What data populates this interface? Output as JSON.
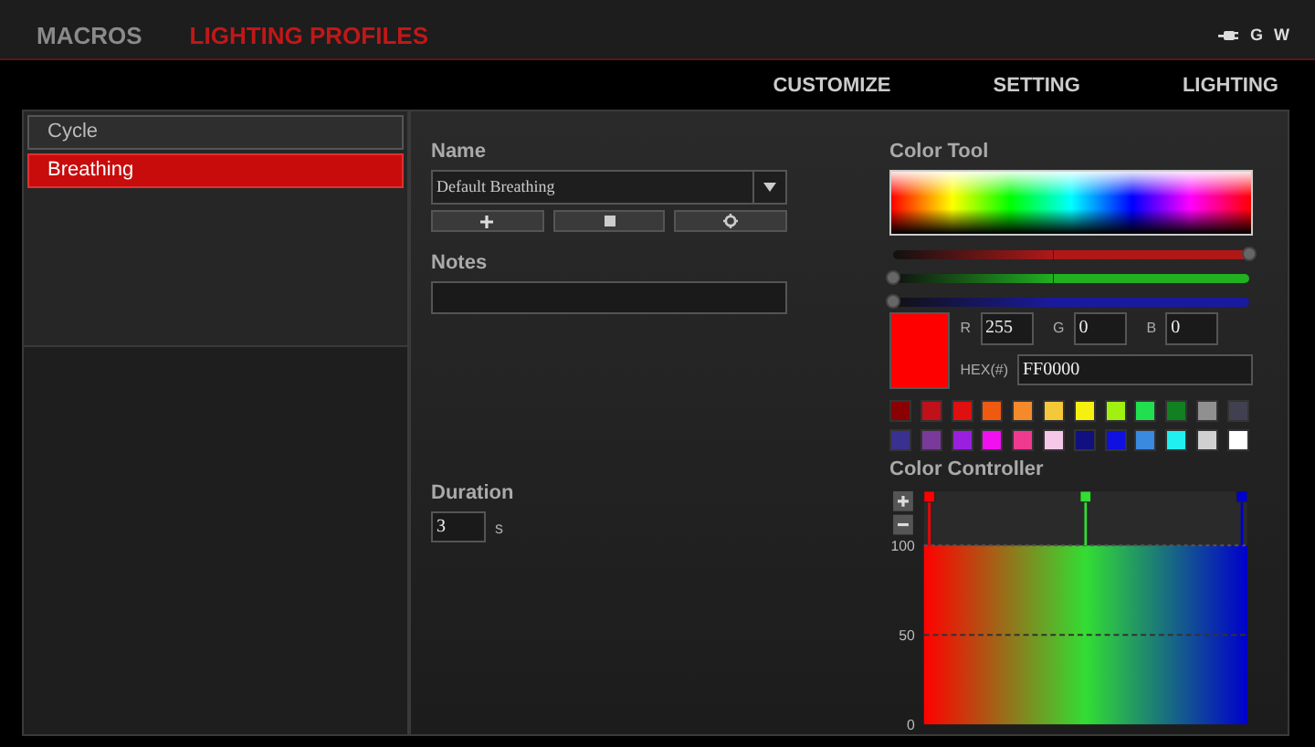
{
  "header": {
    "tabs": [
      {
        "label": "MACROS",
        "selected": false
      },
      {
        "label": "LIGHTING PROFILES",
        "selected": true
      }
    ],
    "toggles": [
      "G",
      "W"
    ]
  },
  "nav": [
    "CUSTOMIZE",
    "SETTING",
    "LIGHTING"
  ],
  "profiles": [
    {
      "label": "Cycle",
      "selected": false
    },
    {
      "label": "Breathing",
      "selected": true
    }
  ],
  "name": {
    "label": "Name",
    "value": "Default Breathing"
  },
  "notes": {
    "label": "Notes"
  },
  "duration": {
    "label": "Duration",
    "value": "3",
    "unit": "s"
  },
  "color_tool": {
    "label": "Color Tool",
    "sliders": [
      {
        "color": "#b01818",
        "level": 1
      },
      {
        "color": "#20b020",
        "level": 0
      },
      {
        "color": "#1a1aa0",
        "level": 0
      }
    ],
    "fields": [
      {
        "label": "R",
        "value": "255"
      },
      {
        "label": "G",
        "value": "0"
      },
      {
        "label": "B",
        "value": "0"
      }
    ],
    "hex": {
      "label": "HEX(#)",
      "value": "FF0000"
    },
    "swatches": [
      {
        "color": "#8b0000"
      },
      {
        "color": "#c0101a"
      },
      {
        "color": "#e01010"
      },
      {
        "color": "#f05a10"
      },
      {
        "color": "#f58a2a"
      },
      {
        "color": "#f5c83a"
      },
      {
        "color": "#f5f010"
      },
      {
        "color": "#a0f010"
      },
      {
        "color": "#20e050"
      },
      {
        "color": "#108020"
      },
      {
        "color": "#909090"
      },
      {
        "color": "#404050"
      },
      {
        "color": "#3a3090"
      },
      {
        "color": "#7a3a9a"
      },
      {
        "color": "#9a20e0"
      },
      {
        "color": "#f010f0"
      },
      {
        "color": "#f03a90"
      },
      {
        "color": "#f5c8e8"
      },
      {
        "color": "#101080"
      },
      {
        "color": "#1010e0"
      },
      {
        "color": "#3a8ae0"
      },
      {
        "color": "#20f0f0"
      },
      {
        "color": "#d0d0d0"
      },
      {
        "color": "#ffffff"
      }
    ]
  },
  "color_controller": {
    "label": "Color Controller",
    "keys": [
      {
        "color": "#ff0000"
      },
      {
        "color": "#33dd33"
      },
      {
        "color": "#0000cc"
      }
    ],
    "y_axis_labels": [
      "100",
      "50",
      "0"
    ]
  }
}
